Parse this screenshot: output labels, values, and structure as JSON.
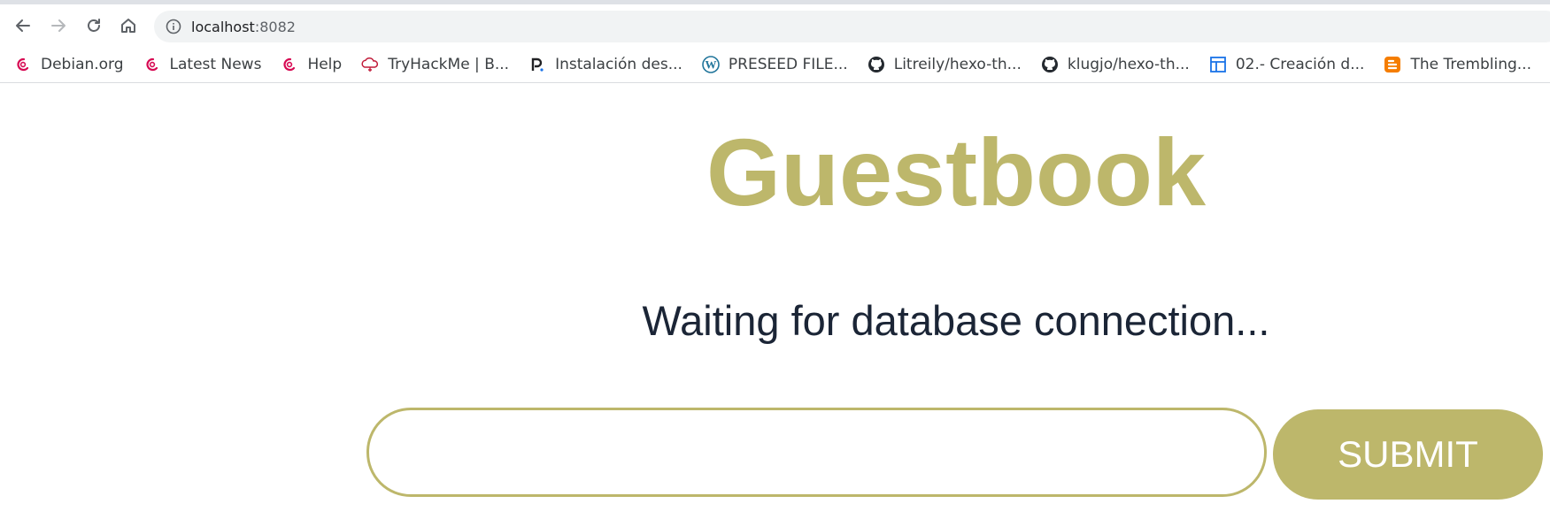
{
  "browser": {
    "url_host": "localhost",
    "url_port": ":8082",
    "bookmarks": [
      {
        "label": "Debian.org",
        "icon": "debian-icon"
      },
      {
        "label": "Latest News",
        "icon": "debian-icon"
      },
      {
        "label": "Help",
        "icon": "debian-icon"
      },
      {
        "label": "TryHackMe | B...",
        "icon": "tryhackme-icon"
      },
      {
        "label": "Instalación des...",
        "icon": "p-icon"
      },
      {
        "label": "PRESEED FILE...",
        "icon": "wordpress-icon"
      },
      {
        "label": "Litreily/hexo-th...",
        "icon": "github-icon"
      },
      {
        "label": "klugjo/hexo-th...",
        "icon": "github-icon"
      },
      {
        "label": "02.- Creación d...",
        "icon": "page-layout-icon"
      },
      {
        "label": "The Trembling...",
        "icon": "blogger-icon"
      }
    ]
  },
  "page": {
    "title": "Guestbook",
    "status": "Waiting for database connection...",
    "entry_value": "",
    "submit_label": "SUBMIT"
  },
  "colors": {
    "accent": "#bdb76b",
    "status_text": "#1b2536"
  }
}
